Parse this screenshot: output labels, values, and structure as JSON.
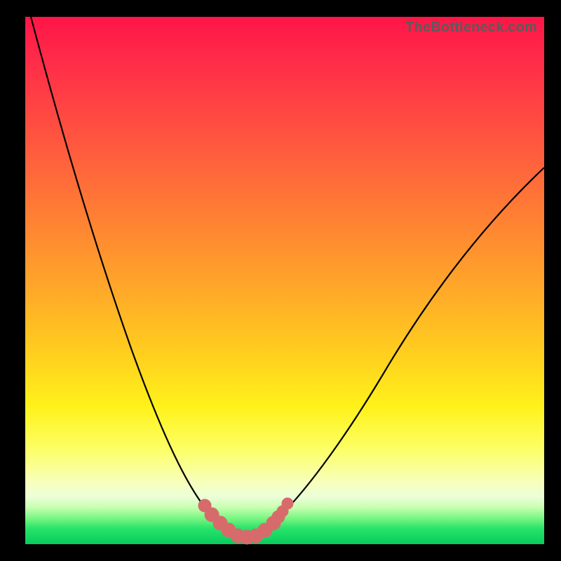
{
  "watermark": "TheBottleneck.com",
  "colors": {
    "frame": "#000000",
    "curve": "#000000",
    "marker": "#d76b6b",
    "gradient_top": "#ff1547",
    "gradient_bottom": "#06cc5d"
  },
  "chart_data": {
    "type": "line",
    "title": "",
    "xlabel": "",
    "ylabel": "",
    "xlim": [
      0,
      100
    ],
    "ylim": [
      0,
      100
    ],
    "x": [
      0,
      5,
      10,
      15,
      20,
      25,
      30,
      33,
      36,
      38,
      40,
      42,
      44,
      46,
      50,
      55,
      60,
      65,
      70,
      75,
      80,
      85,
      90,
      95,
      100
    ],
    "y": [
      100,
      88,
      74,
      60,
      46,
      32,
      18,
      11,
      6,
      3,
      1,
      0,
      1,
      3,
      8,
      16,
      25,
      33,
      41,
      48,
      55,
      61,
      66,
      70,
      73
    ],
    "series": [
      {
        "name": "bottleneck-curve",
        "x": [
          0,
          5,
          10,
          15,
          20,
          25,
          30,
          33,
          36,
          38,
          40,
          42,
          44,
          46,
          50,
          55,
          60,
          65,
          70,
          75,
          80,
          85,
          90,
          95,
          100
        ],
        "y": [
          100,
          88,
          74,
          60,
          46,
          32,
          18,
          11,
          6,
          3,
          1,
          0,
          1,
          3,
          8,
          16,
          25,
          33,
          41,
          48,
          55,
          61,
          66,
          70,
          73
        ]
      }
    ],
    "markers": {
      "name": "highlighted-points",
      "x": [
        33,
        36,
        38,
        40,
        42,
        44,
        46,
        47,
        48,
        49
      ],
      "y": [
        11,
        6,
        3,
        1,
        0,
        1,
        3,
        4,
        5,
        7
      ]
    }
  }
}
